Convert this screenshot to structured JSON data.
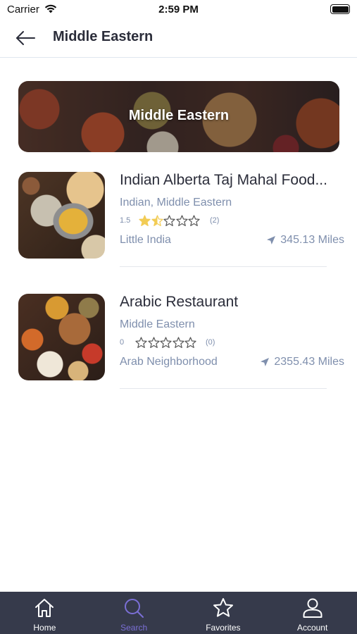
{
  "status_bar": {
    "carrier": "Carrier",
    "time": "2:59 PM"
  },
  "header": {
    "title": "Middle Eastern"
  },
  "banner": {
    "title": "Middle Eastern"
  },
  "restaurants": [
    {
      "name": "Indian Alberta Taj Mahal Food...",
      "cuisines": "Indian, Middle Eastern",
      "rating": "1.5",
      "rating_value": 1.5,
      "reviews": "(2)",
      "area": "Little India",
      "distance": "345.13 Miles"
    },
    {
      "name": "Arabic Restaurant",
      "cuisines": "Middle Eastern",
      "rating": "0",
      "rating_value": 0,
      "reviews": "(0)",
      "area": "Arab Neighborhood",
      "distance": "2355.43 Miles"
    }
  ],
  "tabs": [
    {
      "label": "Home",
      "icon": "home-icon",
      "active": false
    },
    {
      "label": "Search",
      "icon": "search-icon",
      "active": true
    },
    {
      "label": "Favorites",
      "icon": "star-icon",
      "active": false
    },
    {
      "label": "Account",
      "icon": "user-icon",
      "active": false
    }
  ],
  "colors": {
    "accent": "#7b6fd6",
    "star_filled": "#f2cc55",
    "tab_bar": "#363a4b",
    "secondary_text": "#7f8fad"
  }
}
